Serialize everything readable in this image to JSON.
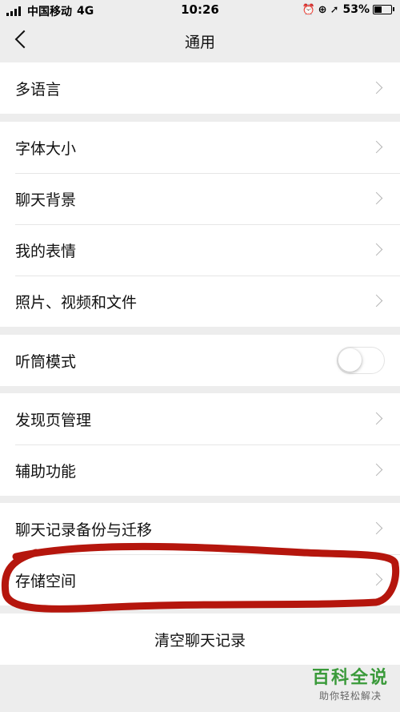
{
  "status_bar": {
    "carrier": "中国移动",
    "network": "4G",
    "time": "10:26",
    "battery": "53%",
    "battery_level": 0.53
  },
  "nav": {
    "title": "通用"
  },
  "groups": [
    {
      "items": [
        "多语言"
      ]
    },
    {
      "items": [
        "字体大小",
        "聊天背景",
        "我的表情",
        "照片、视频和文件"
      ]
    },
    {
      "items": [
        "听筒模式"
      ],
      "toggle_on": false
    },
    {
      "items": [
        "发现页管理",
        "辅助功能"
      ]
    },
    {
      "items": [
        "聊天记录备份与迁移",
        "存储空间"
      ]
    },
    {
      "items": [
        "清空聊天记录"
      ]
    }
  ],
  "colors": {
    "background": "#ededed",
    "annotation_red": "#b5160d",
    "watermark_green": "#3a9a3a"
  },
  "watermark": {
    "main": "百科全说",
    "sub": "助你轻松解决"
  }
}
